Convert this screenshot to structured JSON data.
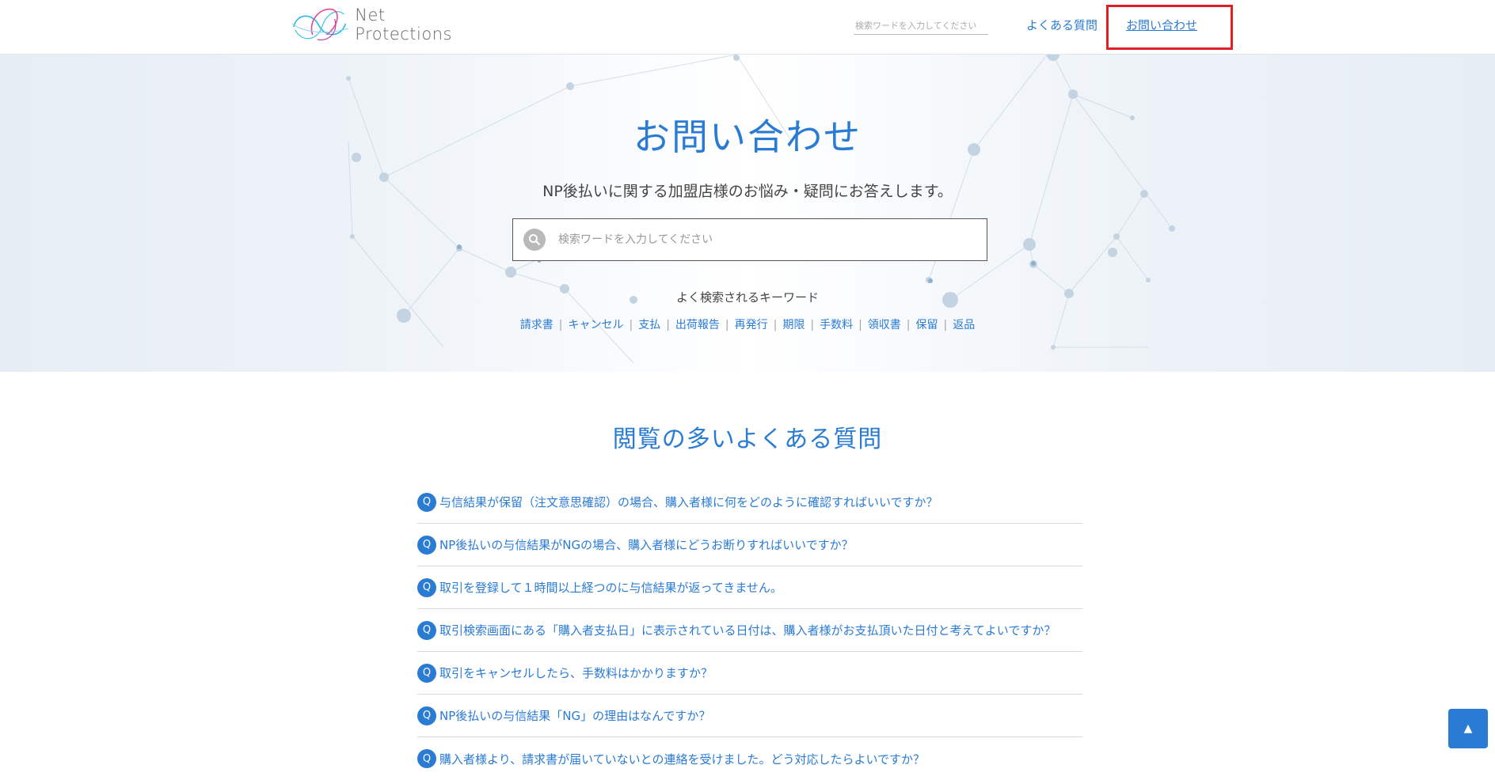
{
  "header": {
    "logo_text": "Net Protections",
    "search_placeholder": "検索ワードを入力してください",
    "nav_faq": "よくある質問",
    "nav_contact": "お問い合わせ"
  },
  "hero": {
    "title": "お問い合わせ",
    "subtitle": "NP後払いに関する加盟店様のお悩み・疑問にお答えします。",
    "search_placeholder": "検索ワードを入力してください",
    "keywords_title": "よく検索されるキーワード",
    "keywords": [
      "請求書",
      "キャンセル",
      "支払",
      "出荷報告",
      "再発行",
      "期限",
      "手数料",
      "領収書",
      "保留",
      "返品"
    ]
  },
  "faq": {
    "title": "閲覧の多いよくある質問",
    "badge": "Q",
    "items": [
      "与信結果が保留（注文意思確認）の場合、購入者様に何をどのように確認すればいいですか？",
      "NP後払いの与信結果がNGの場合、購入者様にどうお断りすればいいですか？",
      "取引を登録して１時間以上経つのに与信結果が返ってきません。",
      "取引検索画面にある「購入者支払日」に表示されている日付は、購入者様がお支払頂いた日付と考えてよいですか？",
      "取引をキャンセルしたら、手数料はかかりますか？",
      "NP後払いの与信結果「NG」の理由はなんですか？",
      "購入者様より、請求書が届いていないとの連絡を受けました。どう対応したらよいですか？"
    ]
  },
  "back_to_top": "▲",
  "colors": {
    "accent": "#2a7bd4",
    "highlight": "#e21f26"
  }
}
